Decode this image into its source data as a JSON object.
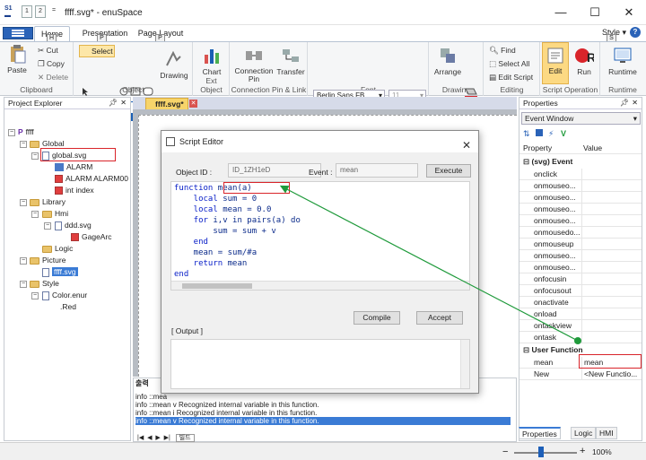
{
  "window": {
    "title": "ffff.svg* - enuSpace",
    "controls": [
      "—",
      "☐",
      "✕"
    ],
    "qat_keys": [
      "1",
      "2"
    ]
  },
  "ribbon_tabs": [
    {
      "label": "Home",
      "key": "H",
      "active": true
    },
    {
      "label": "Presentation",
      "key": "P",
      "active": false
    },
    {
      "label": "Page Layout",
      "key": "P",
      "active": false
    }
  ],
  "style_label": "Style",
  "style_key": "S",
  "ribbon_groups": {
    "clipboard": {
      "label": "Clipboard",
      "paste": "Paste",
      "cut": "Cut",
      "copy": "Copy",
      "delete": "Delete"
    },
    "object": {
      "label": "Object",
      "select": "Select",
      "drawing": "Drawing"
    },
    "chart": {
      "label": "Ext Object",
      "chart": "Chart"
    },
    "connection": {
      "label": "Connection Pin & Link",
      "pin": "Connection Pin",
      "transfer": "Transfer"
    },
    "font": {
      "label": "Font",
      "font_name": "Berlin Sans FB",
      "font_size": "11"
    },
    "drawing": {
      "label": "Drawing",
      "arrange": "Arrange"
    },
    "editing": {
      "label": "Editing",
      "find": "Find",
      "select_all": "Select All",
      "edit_script": "Edit Script"
    },
    "script_op": {
      "label": "Script Operation",
      "edit": "Edit",
      "run": "Run"
    },
    "runtime": {
      "label": "Runtime",
      "runtime": "Runtime"
    }
  },
  "project_explorer": {
    "title": "Project Explorer",
    "tree": [
      {
        "label": "ffff",
        "level": 0,
        "icon": "project"
      },
      {
        "label": "Global",
        "level": 1,
        "icon": "folder"
      },
      {
        "label": "global.svg",
        "level": 2,
        "icon": "svg-file"
      },
      {
        "label": "ALARM",
        "level": 3,
        "icon": "tag"
      },
      {
        "label": "ALARM ALARM00",
        "level": 3,
        "icon": "tag"
      },
      {
        "label": "int index",
        "level": 3,
        "icon": "var"
      },
      {
        "label": "Library",
        "level": 1,
        "icon": "folder"
      },
      {
        "label": "Hmi",
        "level": 2,
        "icon": "folder"
      },
      {
        "label": "ddd.svg",
        "level": 3,
        "icon": "svg-file"
      },
      {
        "label": "GageArc",
        "level": 4,
        "icon": "symbol"
      },
      {
        "label": "Logic",
        "level": 2,
        "icon": "folder"
      },
      {
        "label": "Picture",
        "level": 1,
        "icon": "folder"
      },
      {
        "label": "ffff.svg",
        "level": 2,
        "icon": "svg-file",
        "selected": true
      },
      {
        "label": "Style",
        "level": 1,
        "icon": "folder"
      },
      {
        "label": "Color.enur",
        "level": 2,
        "icon": "file"
      },
      {
        "label": ".Red",
        "level": 3,
        "icon": "color"
      }
    ]
  },
  "document_tab": {
    "label": "ffff.svg*"
  },
  "output": {
    "tab_label": "출력",
    "lines": [
      "info ::mea",
      "info ::mean v Recognized internal variable in this function.",
      "info ::mean i Recognized internal variable in this function.",
      "info ::mean v Recognized internal variable in this function."
    ],
    "footer_tab": "빌드"
  },
  "script_editor": {
    "title": "Script Editor",
    "object_id_label": "Object ID :",
    "object_id_value": "ID_1ZH1eD",
    "event_label": "Event :",
    "event_value": "mean",
    "execute_label": "Execute",
    "code": [
      {
        "kw": "function",
        "rest": " mean(a)"
      },
      {
        "kw": "    local",
        "rest": " sum = 0"
      },
      {
        "kw": "    local",
        "rest": " mean = 0.0"
      },
      {
        "kw": "    for",
        "rest": " i,v in pairs(a) do"
      },
      {
        "kw": "",
        "rest": "        sum = sum + v"
      },
      {
        "kw": "    end",
        "rest": ""
      },
      {
        "kw": "",
        "rest": "    mean = sum/#a"
      },
      {
        "kw": "    return",
        "rest": " mean"
      },
      {
        "kw": "end",
        "rest": ""
      }
    ],
    "compile_label": "Compile",
    "accept_label": "Accept",
    "output_label": "[ Output ]"
  },
  "properties": {
    "title": "Properties",
    "combo": "Event Window",
    "col_property": "Property",
    "col_value": "Value",
    "svg_event_section": "(svg) Event",
    "events": [
      "onclick",
      "onmouseo...",
      "onmouseo...",
      "onmouseo...",
      "onmouseo...",
      "onmousedo...",
      "onmouseup",
      "onmouseo...",
      "onmouseo...",
      "onfocusin",
      "onfocusout",
      "onactivate",
      "onload",
      "ontaskview",
      "ontask"
    ],
    "user_function_section": "User Function",
    "functions": [
      {
        "name": "mean",
        "value": "mean"
      },
      {
        "name": "New",
        "value": "<New Functio..."
      }
    ],
    "tabs": [
      "Properties",
      "Logic",
      "HMI"
    ]
  },
  "statusbar": {
    "zoom": "100%"
  },
  "colors": {
    "accent": "#2a63b8",
    "annotation": "#d9242a",
    "connector": "#1f9a3b"
  }
}
